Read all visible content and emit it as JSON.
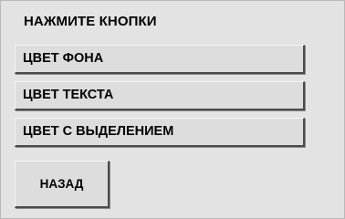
{
  "panel": {
    "title": "НАЖМИТЕ КНОПКИ"
  },
  "buttons": [
    {
      "label": "ЦВЕТ ФОНА"
    },
    {
      "label": "ЦВЕТ ТЕКСТА"
    },
    {
      "label": "ЦВЕТ С ВЫДЕЛЕНИЕМ"
    }
  ],
  "back_button": {
    "label": "НАЗАД"
  },
  "colors": {
    "background": "#e3e3e3",
    "button_face": "#dddddd",
    "button_shadow": "#4a4a4a",
    "text": "#000000"
  }
}
